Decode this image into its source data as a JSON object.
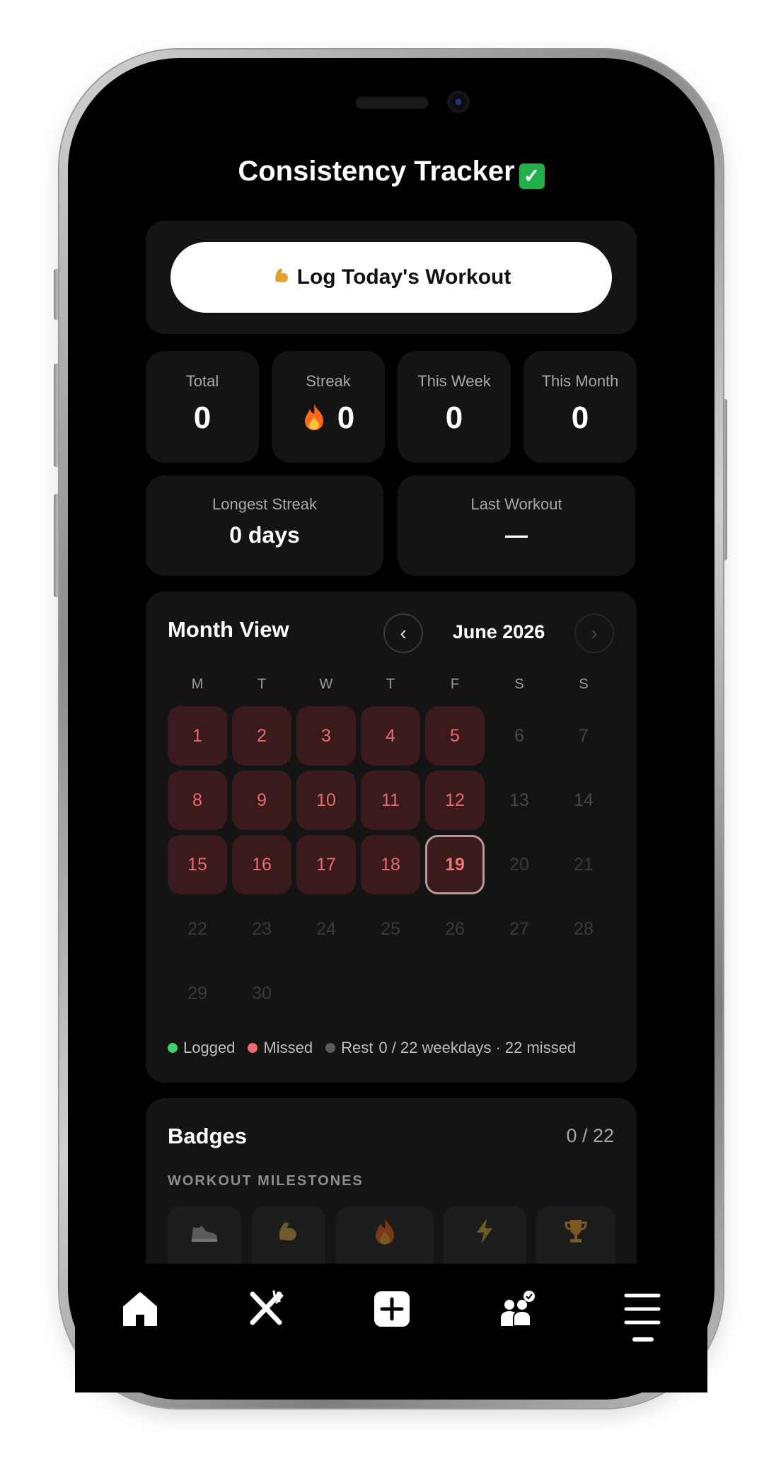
{
  "app": {
    "title": "Consistency Tracker",
    "title_emoji": "✅"
  },
  "log_button": {
    "icon": "flexed-biceps-icon",
    "label": "Log Today's Workout"
  },
  "stats": [
    {
      "label": "Total",
      "value": "0"
    },
    {
      "label": "Streak",
      "value": "0",
      "icon": "fire-icon"
    },
    {
      "label": "This Week",
      "value": "0"
    },
    {
      "label": "This Month",
      "value": "0"
    }
  ],
  "summary": [
    {
      "label": "Longest Streak",
      "value": "0 days"
    },
    {
      "label": "Last Workout",
      "value": "—"
    }
  ],
  "month_view": {
    "title": "Month View",
    "prev_symbol": "‹",
    "next_symbol": "›",
    "month_label": "June 2026",
    "weekdays": [
      "M",
      "T",
      "W",
      "T",
      "F",
      "S",
      "S"
    ],
    "days": [
      "1",
      "2",
      "3",
      "4",
      "5",
      "6",
      "7",
      "8",
      "9",
      "10",
      "11",
      "12",
      "13",
      "14",
      "15",
      "16",
      "17",
      "18",
      "19",
      "20",
      "21",
      "22",
      "23",
      "24",
      "25",
      "26",
      "27",
      "28",
      "29",
      "30"
    ],
    "today": "19",
    "legend": {
      "logged": "Logged",
      "missed": "Missed",
      "rest": "Rest",
      "summary": "0 / 22 weekdays · 22 missed"
    },
    "colors": {
      "logged": "#3ecf6e",
      "missed": "#ee6a6f",
      "rest": "#5a5a5a"
    }
  },
  "badges": {
    "title": "Badges",
    "count": "0 / 22",
    "section": "WORKOUT MILESTONES",
    "items": [
      "sneaker-icon",
      "flexed-biceps-icon",
      "fire-icon",
      "lightning-icon",
      "trophy-icon"
    ]
  },
  "bottom_nav": [
    "home-icon",
    "fork-knife-icon",
    "add-icon",
    "community-icon",
    "menu-icon"
  ]
}
